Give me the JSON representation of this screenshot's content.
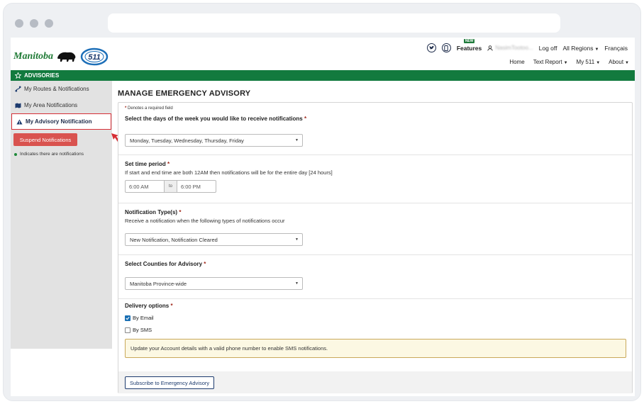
{
  "header": {
    "logo_text": "Manitoba",
    "logo_badge": "511",
    "new_tag": "NEW",
    "features": "Features",
    "username": "NasimTootoo...",
    "log_off": "Log off",
    "regions": "All Regions",
    "language": "Français",
    "subnav": {
      "home": "Home",
      "text_report": "Text Report",
      "my511": "My 511",
      "about": "About"
    }
  },
  "advisories_bar": "ADVISORIES",
  "sidebar": {
    "items": [
      {
        "label": "My Routes & Notifications"
      },
      {
        "label": "My Area Notifications"
      },
      {
        "label": "My Advisory Notification"
      }
    ],
    "suspend_label": "Suspend Notifications",
    "legend_note": "Indicates there are notifications"
  },
  "main": {
    "title": "MANAGE EMERGENCY ADVISORY",
    "required_note": "Denotes a required field",
    "days": {
      "label": "Select the days of the week you would like to receive notifications",
      "value": "Monday, Tuesday, Wednesday, Thursday, Friday"
    },
    "time": {
      "label": "Set time period",
      "help": "If start and end time are both 12AM then notifications will be for the entire day [24 hours]",
      "start": "6:00 AM",
      "to": "to",
      "end": "6:00 PM"
    },
    "types": {
      "label": "Notification Type(s)",
      "help": "Receive a notification when the following types of notifications occur",
      "value": "New Notification, Notification Cleared"
    },
    "counties": {
      "label": "Select Counties for Advisory",
      "value": "Manitoba Province-wide"
    },
    "delivery": {
      "label": "Delivery options",
      "email": "By Email",
      "email_checked": true,
      "sms": "By SMS",
      "sms_checked": false,
      "alert": "Update your Account details with a valid phone number to enable SMS notifications."
    },
    "subscribe_label": "Subscribe to Emergency Advisory"
  },
  "colors": {
    "brand_green": "#127a3e",
    "danger": "#d9534f",
    "highlight": "#d62e35",
    "required": "#a0281b"
  }
}
